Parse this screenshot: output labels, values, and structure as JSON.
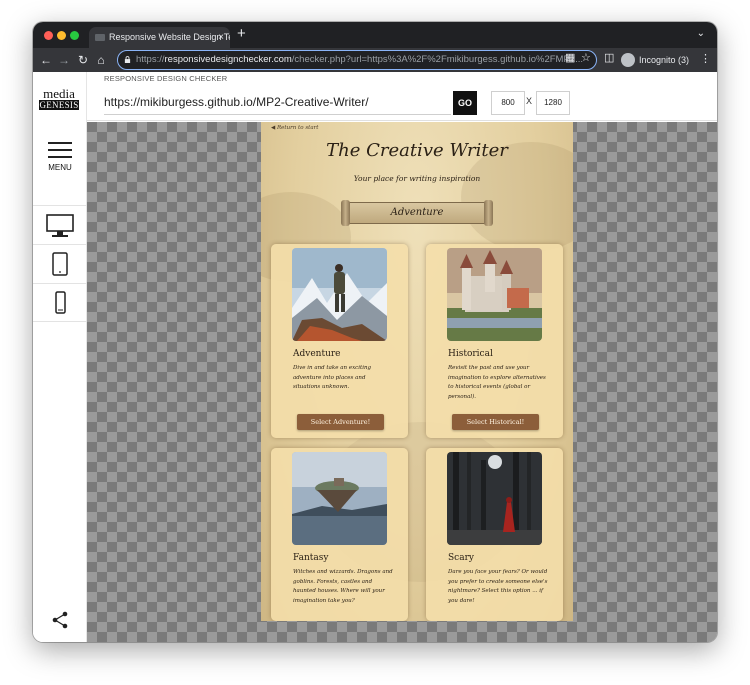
{
  "browser": {
    "tab_title": "Responsive Website Design Te",
    "tab_close": "×",
    "new_tab": "+",
    "url_scheme": "https://",
    "url_host": "responsivedesignchecker.com",
    "url_rest": "/checker.php?url=https%3A%2F%2Fmikiburgess.github.io%2FMP2...",
    "incognito_label": "Incognito (3)"
  },
  "app": {
    "logo_top": "media",
    "logo_bottom": "GENESIS",
    "menu_label": "MENU",
    "header_label": "RESPONSIVE DESIGN CHECKER",
    "url_value": "https://mikiburgess.github.io/MP2-Creative-Writer/",
    "go_label": "GO",
    "width_value": "800",
    "height_value": "1280",
    "dim_separator": "X"
  },
  "site": {
    "return_link": "Return to start",
    "title": "The Creative Writer",
    "subtitle": "Your place for writing inspiration",
    "banner": "Adventure",
    "cards": [
      {
        "title": "Adventure",
        "text": "Dive in and take an exciting adventure into places and situations unknown.",
        "button": "Select Adventure!",
        "image": "hiker-mountains"
      },
      {
        "title": "Historical",
        "text": "Revisit the past and use your imagination to explore alternatives to historical events (global or personal).",
        "button": "Select Historical!",
        "image": "castle"
      },
      {
        "title": "Fantasy",
        "text": "Witches and wizzards. Dragons and goblins. Forests, castles and haunted houses. Where will your imagination take you?",
        "button": "",
        "image": "floating-island"
      },
      {
        "title": "Scary",
        "text": "Dare you face your fears? Or would you prefer to create someone else's nightmare? Select this option ... if you dare!",
        "button": "",
        "image": "dark-forest-figure"
      }
    ]
  },
  "colors": {
    "accent_button": "#8c5e3a",
    "omnibox_focus": "#8ab4f8",
    "parchment": "#e3cf9f"
  }
}
